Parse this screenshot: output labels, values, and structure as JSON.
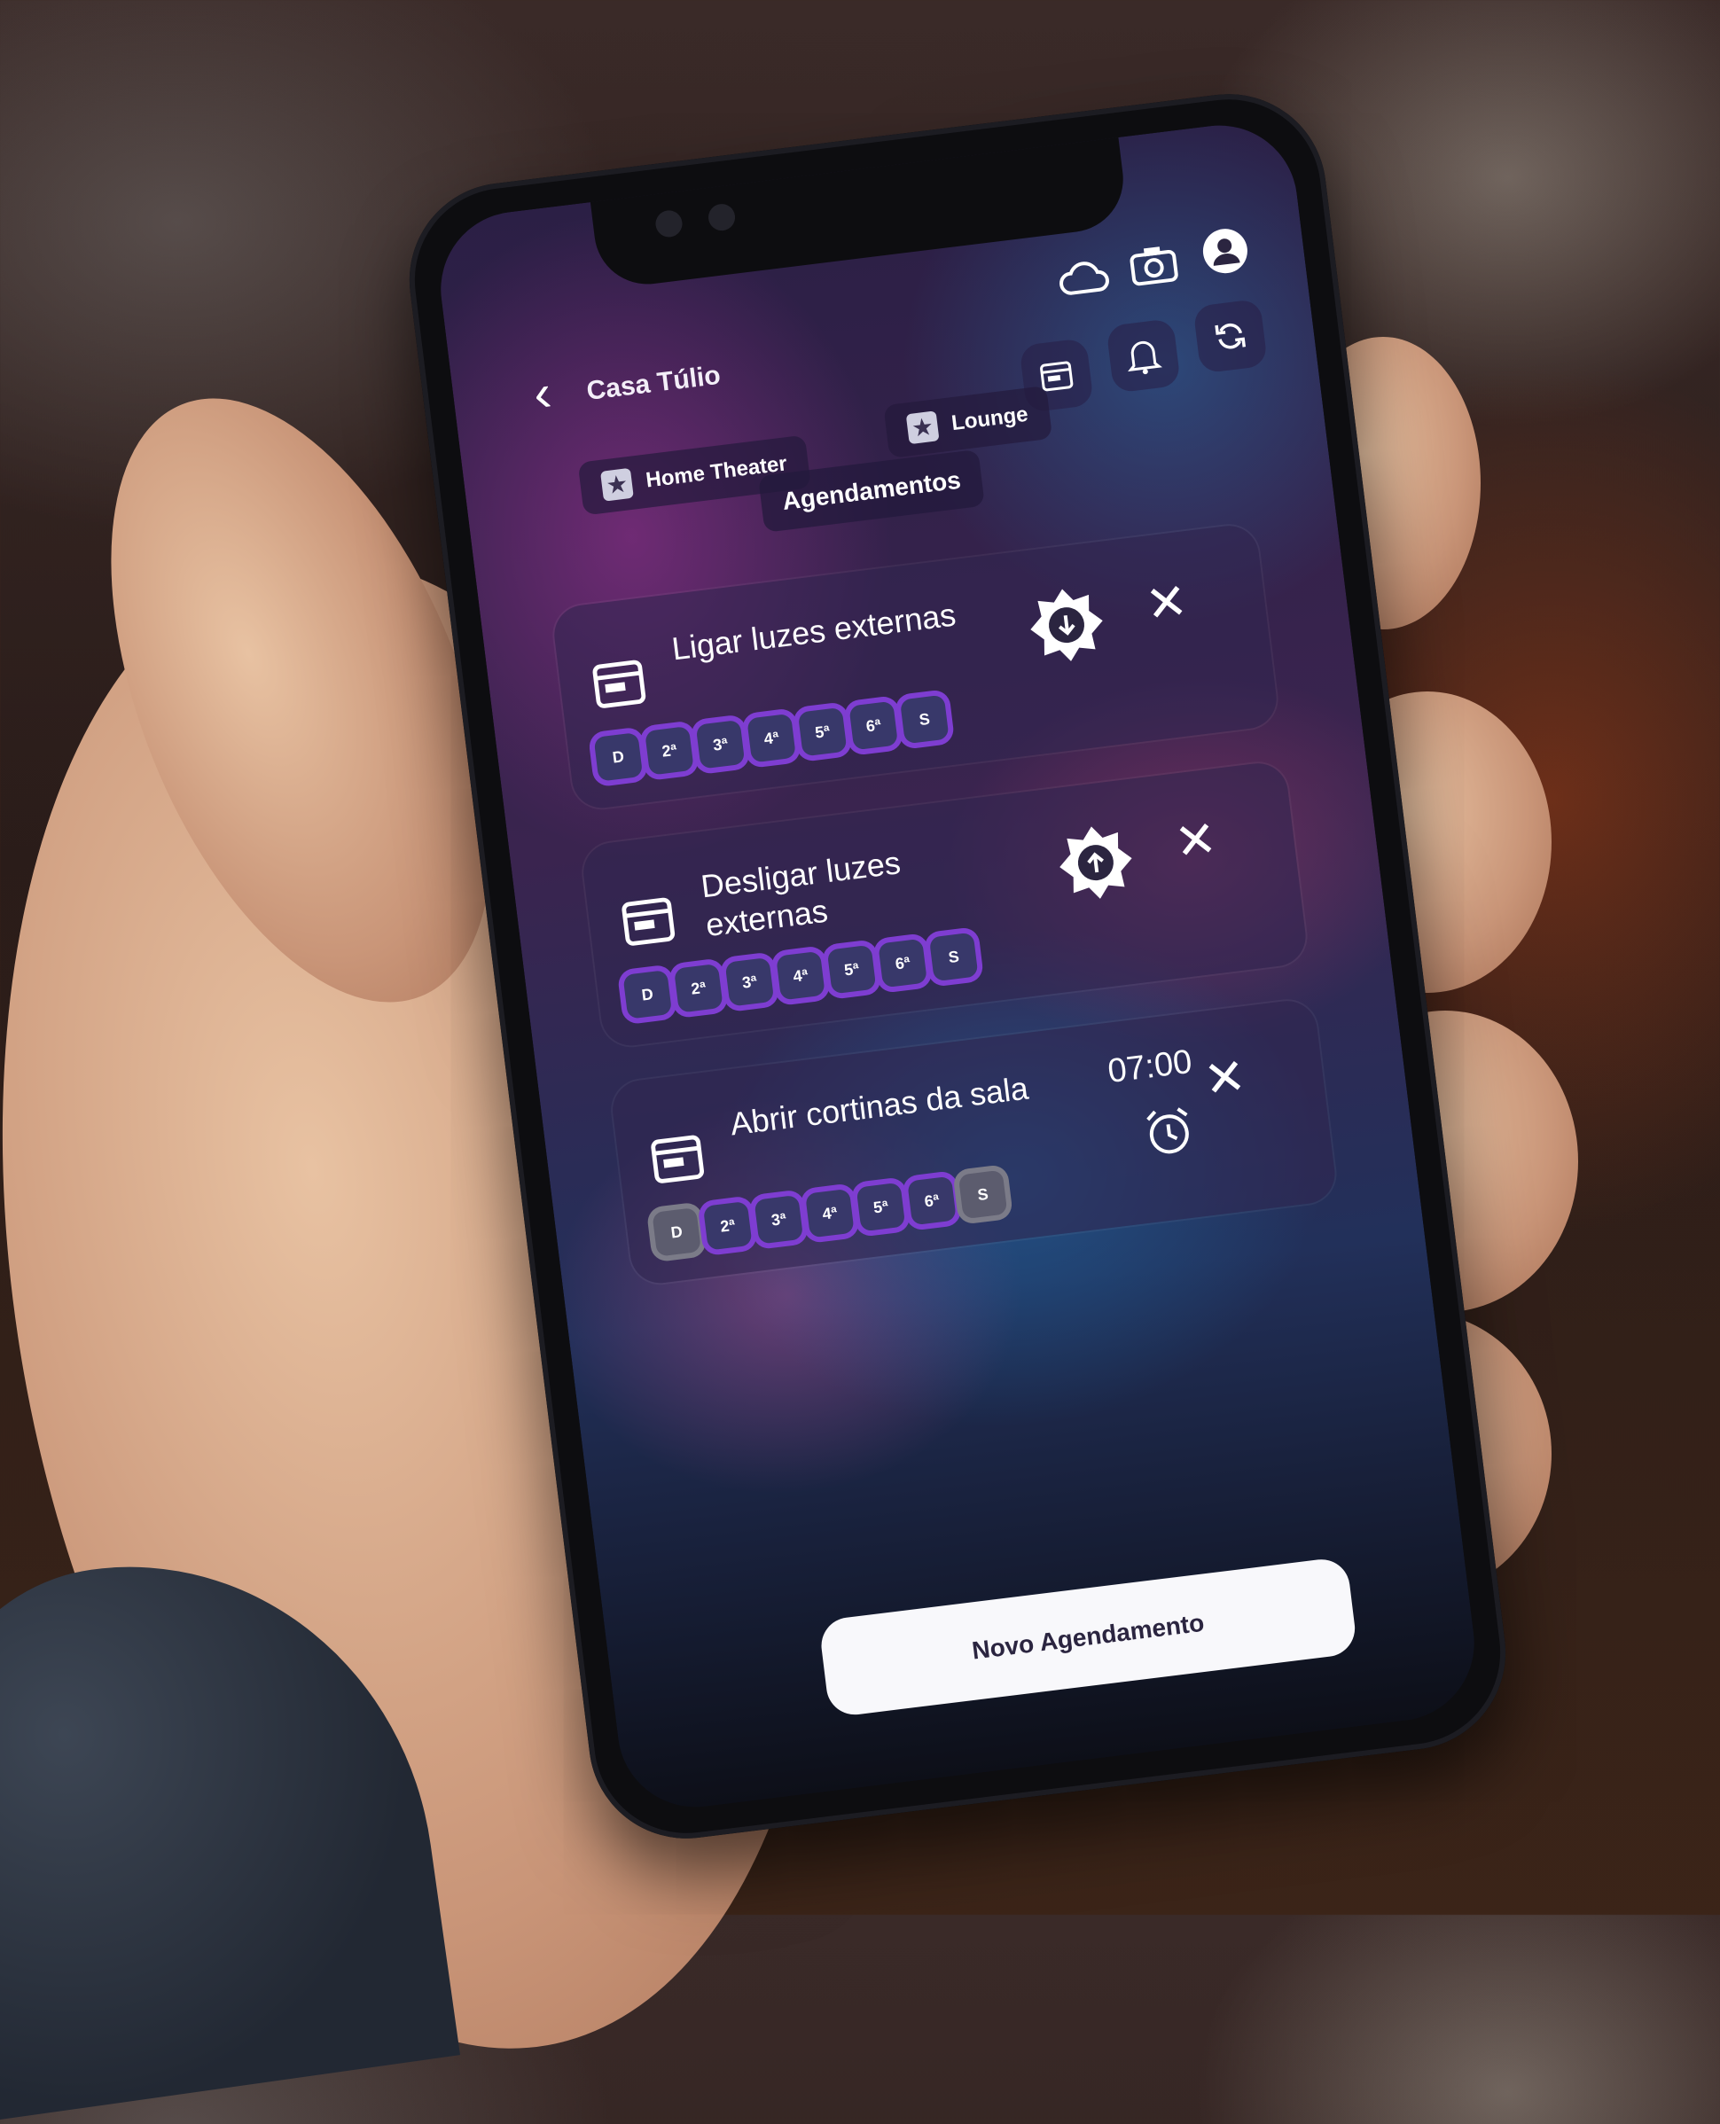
{
  "header": {
    "title": "Casa Túlio"
  },
  "top_icons": [
    "cloud-icon",
    "camera-icon",
    "user-icon"
  ],
  "header_buttons": [
    "calendar-icon",
    "bell-icon",
    "refresh-icon"
  ],
  "favorites": [
    {
      "label": "Home Theater",
      "icon": "star-icon"
    },
    {
      "label": "Lounge",
      "icon": "star-icon"
    }
  ],
  "section_title": "Agendamentos",
  "schedules": [
    {
      "title": "Ligar luzes externas",
      "trigger": "sunset-icon",
      "days": [
        {
          "label": "D",
          "active": true
        },
        {
          "label": "2ª",
          "active": true
        },
        {
          "label": "3ª",
          "active": true
        },
        {
          "label": "4ª",
          "active": true
        },
        {
          "label": "5ª",
          "active": true
        },
        {
          "label": "6ª",
          "active": true
        },
        {
          "label": "S",
          "active": true
        }
      ]
    },
    {
      "title": "Desligar luzes externas",
      "trigger": "sunrise-icon",
      "days": [
        {
          "label": "D",
          "active": true
        },
        {
          "label": "2ª",
          "active": true
        },
        {
          "label": "3ª",
          "active": true
        },
        {
          "label": "4ª",
          "active": true
        },
        {
          "label": "5ª",
          "active": true
        },
        {
          "label": "6ª",
          "active": true
        },
        {
          "label": "S",
          "active": true
        }
      ]
    },
    {
      "title": "Abrir cortinas da sala",
      "time": "07:00",
      "trigger": "alarm-icon",
      "days": [
        {
          "label": "D",
          "active": false
        },
        {
          "label": "2ª",
          "active": true
        },
        {
          "label": "3ª",
          "active": true
        },
        {
          "label": "4ª",
          "active": true
        },
        {
          "label": "5ª",
          "active": true
        },
        {
          "label": "6ª",
          "active": true
        },
        {
          "label": "S",
          "active": false
        }
      ]
    }
  ],
  "cta_label": "Novo Agendamento",
  "colors": {
    "accent": "#7e3dd1",
    "active_day": "#38386a",
    "inactive_day": "#5c5c6e"
  }
}
